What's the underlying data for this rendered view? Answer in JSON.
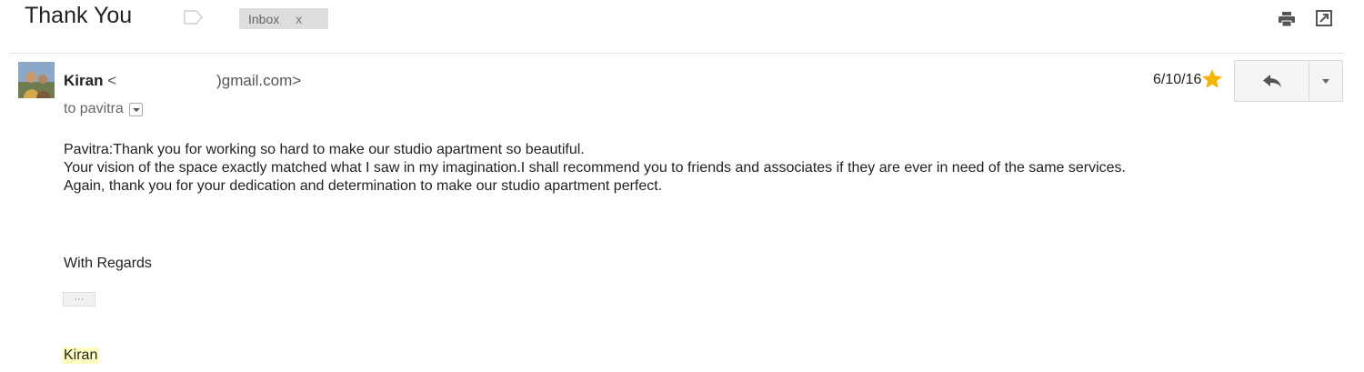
{
  "thread": {
    "subject": "Thank You",
    "label_chip": "Inbox",
    "label_chip_close": "x"
  },
  "message": {
    "sender_name": "Kiran",
    "sender_email_open": "<",
    "sender_email_tail": ")gmail.com>",
    "to_line": "to pavitra",
    "date": "6/10/16",
    "starred": true,
    "body_lines": [
      "Pavitra:Thank you for working so hard to make our studio apartment so beautiful.",
      "Your vision of the space exactly matched what I saw in my imagination.I shall recommend you to friends and associates if they are ever in need of the same services.",
      "Again, thank you for your dedication and determination to make our studio apartment perfect."
    ],
    "closing": "With Regards",
    "trimmed_content": "···",
    "signature": "Kiran"
  },
  "colors": {
    "star": "#f7b500",
    "signature_highlight": "#ffffc0",
    "chip_bg": "#dddddd"
  },
  "icons": {
    "label": "label-tag-icon",
    "print": "print-icon",
    "new_window": "new-window-icon",
    "reply": "reply-icon",
    "more": "chevron-down-icon",
    "star": "star-icon"
  }
}
